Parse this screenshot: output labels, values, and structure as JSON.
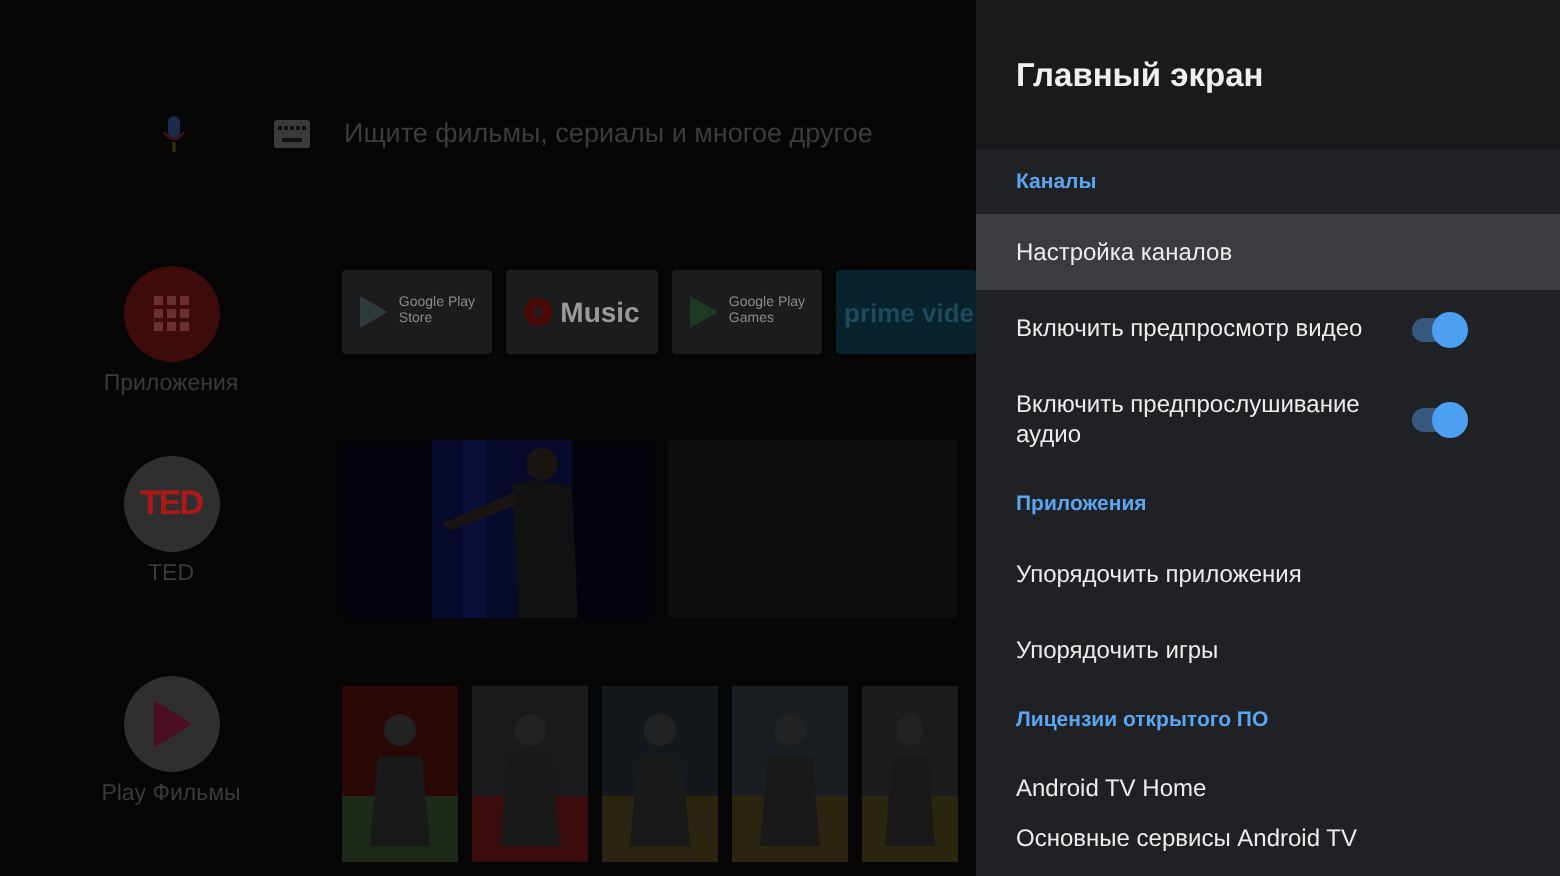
{
  "search": {
    "placeholder": "Ищите фильмы, сериалы и многое другое"
  },
  "channels": [
    {
      "kind": "apps",
      "label": "Приложения"
    },
    {
      "kind": "ted",
      "logo": "TED",
      "label": "TED"
    },
    {
      "kind": "movies",
      "label": "Play Фильмы"
    }
  ],
  "app_tiles": [
    {
      "kind": "play-store",
      "line_1": "Google Play",
      "line_2": "Store"
    },
    {
      "kind": "music",
      "label": "Music"
    },
    {
      "kind": "play-games",
      "line_1": "Google Play",
      "line_2": "Games"
    },
    {
      "kind": "prime",
      "label": "prime vide"
    }
  ],
  "video_tiles": [
    {
      "kind": "picture"
    },
    {
      "kind": "empty"
    }
  ],
  "posters": [
    {
      "kind": "picture"
    },
    {
      "kind": "picture"
    },
    {
      "kind": "picture"
    },
    {
      "kind": "picture"
    },
    {
      "kind": "picture"
    }
  ],
  "panel": {
    "title": "Главный экран",
    "items": [
      {
        "kind": "header",
        "label": "Каналы"
      },
      {
        "kind": "item",
        "label": "Настройка каналов",
        "selected": true
      },
      {
        "kind": "toggle",
        "label": "Включить предпросмотр видео",
        "on": true,
        "selected": false
      },
      {
        "kind": "toggle",
        "label": "Включить предпрослушивание аудио",
        "on": true,
        "selected": false
      },
      {
        "kind": "header",
        "label": "Приложения"
      },
      {
        "kind": "item",
        "label": "Упорядочить приложения",
        "selected": false
      },
      {
        "kind": "item",
        "label": "Упорядочить игры",
        "selected": false
      },
      {
        "kind": "header",
        "label": "Лицензии открытого ПО"
      },
      {
        "kind": "item",
        "label": "Android TV Home",
        "selected": false
      },
      {
        "kind": "item",
        "label": "Основные сервисы Android TV",
        "selected": false
      }
    ]
  }
}
